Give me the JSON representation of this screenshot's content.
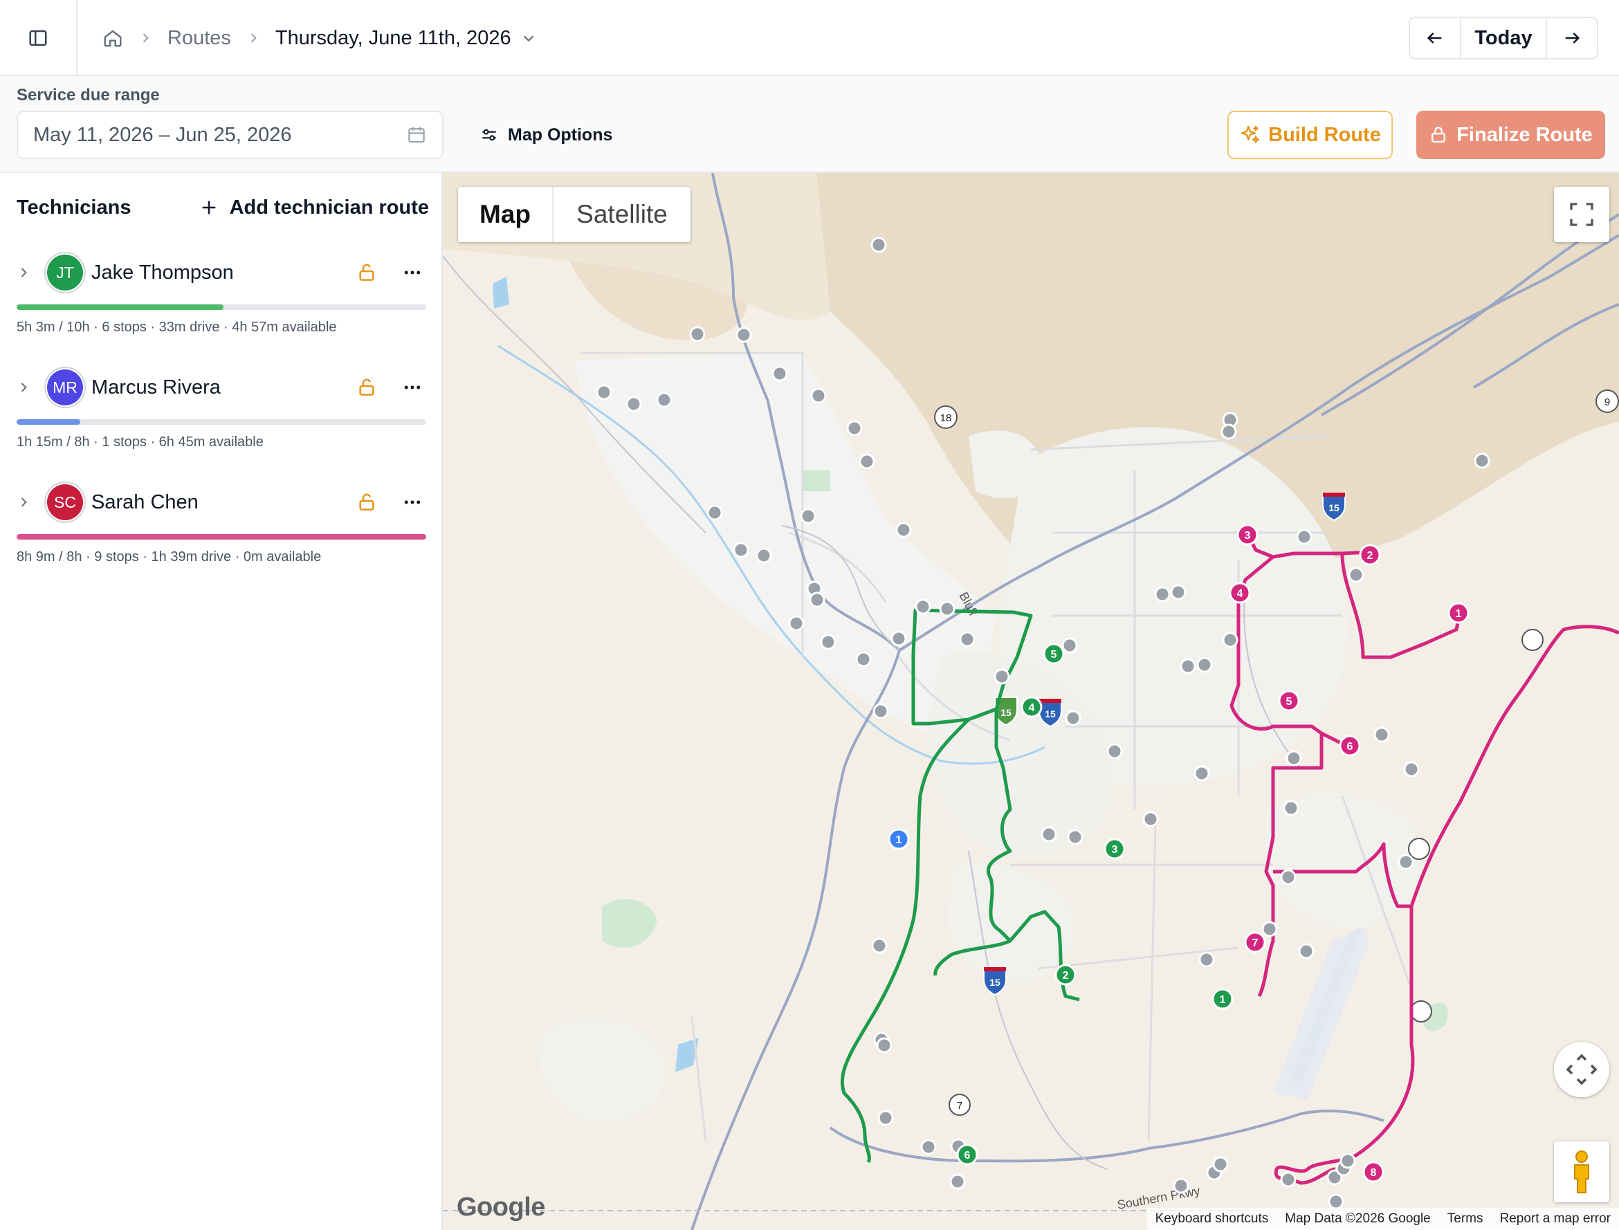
{
  "breadcrumb": {
    "routes": "Routes",
    "current_date": "Thursday, June 11th, 2026"
  },
  "date_nav": {
    "today": "Today"
  },
  "filters": {
    "range_label": "Service due range",
    "range_value": "May 11, 2026 – Jun 25, 2026",
    "map_options": "Map Options"
  },
  "actions": {
    "build_route": "Build Route",
    "finalize_route": "Finalize Route"
  },
  "colors": {
    "green_route": "#1e9b4c",
    "blue_route": "#3b82f6",
    "pink_route": "#d4267f",
    "idle_stop": "#9aa0a8",
    "build_accent": "#e69418",
    "finalize_bg": "#e9917a"
  },
  "sidebar": {
    "title": "Technicians",
    "add_label": "Add technician route",
    "technicians": [
      {
        "initials": "JT",
        "name": "Jake Thompson",
        "stats": "5h 3m / 10h · 6 stops · 33m drive · 4h 57m available",
        "color": "#1e9b4c",
        "bar_color": "#4cba6b",
        "utilization": 0.505
      },
      {
        "initials": "MR",
        "name": "Marcus Rivera",
        "stats": "1h 15m / 8h · 1 stops · 6h 45m available",
        "color": "#4f46e5",
        "bar_color": "#6b93e8",
        "utilization": 0.156
      },
      {
        "initials": "SC",
        "name": "Sarah Chen",
        "stats": "8h 9m / 8h · 9 stops · 1h 39m drive · 0m available",
        "color": "#c81e3c",
        "bar_color": "#db4f8c",
        "utilization": 1.0
      }
    ]
  },
  "map": {
    "type_map": "Map",
    "type_satellite": "Satellite",
    "logo": "Google",
    "road_label_bluff": "Bluff",
    "road_label_southern": "Southern Pkwy",
    "shields": [
      "18",
      "9",
      "15",
      "15",
      "15",
      "15",
      "7"
    ],
    "attribution": {
      "shortcuts": "Keyboard shortcuts",
      "data": "Map Data ©2026 Google",
      "terms": "Terms",
      "report": "Report a map error"
    },
    "green_stops": [
      "1",
      "2",
      "3",
      "4",
      "5",
      "6"
    ],
    "blue_stops": [
      "1"
    ],
    "pink_stops": [
      "1",
      "2",
      "3",
      "4",
      "5",
      "6",
      "7",
      "8"
    ]
  }
}
